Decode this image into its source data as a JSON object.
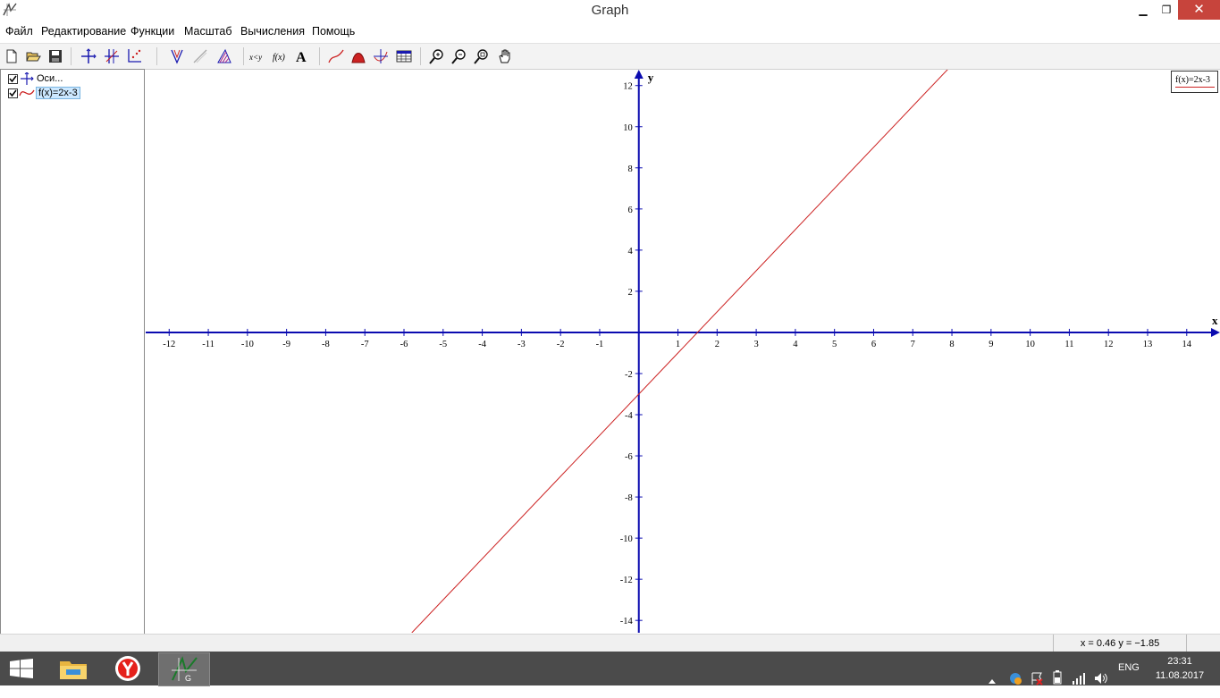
{
  "window": {
    "title": "Graph",
    "app_icon": "graph-app-icon",
    "controls": {
      "minimize": "▁",
      "maximize": "❐",
      "close": "✕"
    }
  },
  "menu": [
    "Файл",
    "Редактирование",
    "Функции",
    "Масштаб",
    "Вычисления",
    "Помощь"
  ],
  "toolbar": {
    "buttons": [
      "new-file-icon",
      "open-folder-icon",
      "save-disk-icon",
      "axes-icon",
      "insert-point-series-icon",
      "insert-relation-icon",
      "insert-function-icon",
      "insert-tangent-icon",
      "insert-shading-icon",
      "relation-xy-icon",
      "custom-function-icon",
      "insert-label-icon",
      "evaluate-icon",
      "area-icon",
      "table-icon",
      "zoom-in-icon",
      "zoom-out-icon",
      "zoom-window-icon",
      "pan-hand-icon"
    ]
  },
  "tree": {
    "items": [
      {
        "label": "Оси...",
        "checked": true,
        "icon": "axes-icon",
        "selected": false
      },
      {
        "label": "f(x)=2x-3",
        "checked": true,
        "icon": "function-curve-icon",
        "selected": true
      }
    ]
  },
  "legend": {
    "label": "f(x)=2x-3",
    "color": "#cc2222"
  },
  "chart_data": {
    "type": "line",
    "xlabel": "x",
    "ylabel": "y",
    "xlim": [
      -12.6,
      14.85
    ],
    "ylim": [
      -14.6,
      12.77
    ],
    "x_ticks": [
      -12,
      -11,
      -10,
      -9,
      -8,
      -7,
      -6,
      -5,
      -4,
      -3,
      -2,
      -1,
      1,
      2,
      3,
      4,
      5,
      6,
      7,
      8,
      9,
      10,
      11,
      12,
      13,
      14
    ],
    "y_ticks": [
      12,
      10,
      8,
      6,
      4,
      2,
      -2,
      -4,
      -6,
      -8,
      -10,
      -12,
      -14
    ],
    "grid": false,
    "series": [
      {
        "name": "f(x)=2x-3",
        "slope": 2,
        "intercept": -3,
        "x": [
          -5.8,
          7.9
        ],
        "y": [
          -14.6,
          12.8
        ],
        "color": "#cc2222"
      }
    ],
    "axis_color": "#0b0bb0"
  },
  "status": {
    "coords": "x = 0.46    y = −1.85"
  },
  "taskbar": {
    "apps": [
      "windows-start-icon",
      "file-explorer-icon",
      "yandex-browser-icon",
      "graph-app-icon"
    ],
    "tray": {
      "lang": "ENG",
      "time": "23:31",
      "date": "11.08.2017"
    }
  }
}
